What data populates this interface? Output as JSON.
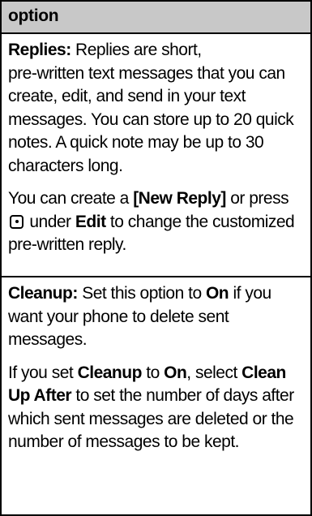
{
  "table": {
    "header": "option",
    "replies": {
      "term": "Replies:",
      "desc_line1": "Replies are short,",
      "desc_rest": "pre-written text messages that you can create, edit, and send in your text messages. You can store up to 20 quick notes. A quick note may be up to 30 characters long.",
      "p2_a": "You can create a",
      "p2_new_reply": "[New Reply]",
      "p2_b": "or press",
      "p2_key_icon": "center-select-key-icon",
      "p2_c": "under",
      "p2_edit": "Edit",
      "p2_d": "to change the customized",
      "p2_e": "pre-written reply."
    },
    "cleanup": {
      "term": "Cleanup:",
      "p1_a": "Set this option to",
      "p1_on": "On",
      "p1_b": "if you want your phone to delete sent messages.",
      "p2_a": "If you set",
      "p2_cleanup": "Cleanup",
      "p2_to": "to",
      "p2_on": "On",
      "p2_select": ", select",
      "p2_clean_up_after": "Clean Up After",
      "p2_b": "to set the number of days after which sent messages are deleted or the number of messages to be kept."
    }
  }
}
